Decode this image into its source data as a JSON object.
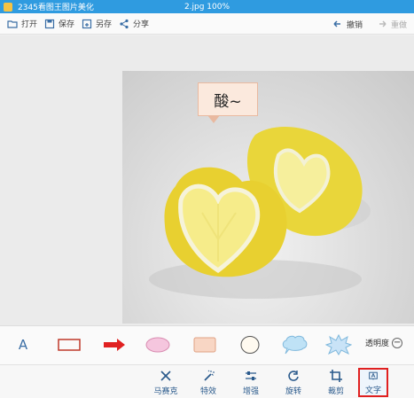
{
  "titlebar": {
    "app_name": "2345看图王图片美化",
    "file_info": "2.jpg  100%"
  },
  "toolbar": {
    "open": "打开",
    "save": "保存",
    "save_as": "另存",
    "share": "分享",
    "undo": "撤销",
    "redo": "重做"
  },
  "canvas": {
    "speech_text": "酸~"
  },
  "shapes": {
    "text_tool": "A",
    "opacity_label": "透明度",
    "opacity_minus": "−",
    "colors": {
      "rect": "#c0392b",
      "arrow": "#e02020",
      "ellipse": "#f5c6de",
      "rounded_rect": "#f8d6c4",
      "cloud": "#bfe2f6",
      "burst": "#c9e3f7"
    }
  },
  "tools": {
    "mosaic": "马赛克",
    "effects": "特效",
    "enhance": "增强",
    "rotate": "旋转",
    "crop": "裁剪",
    "text": "文字"
  }
}
